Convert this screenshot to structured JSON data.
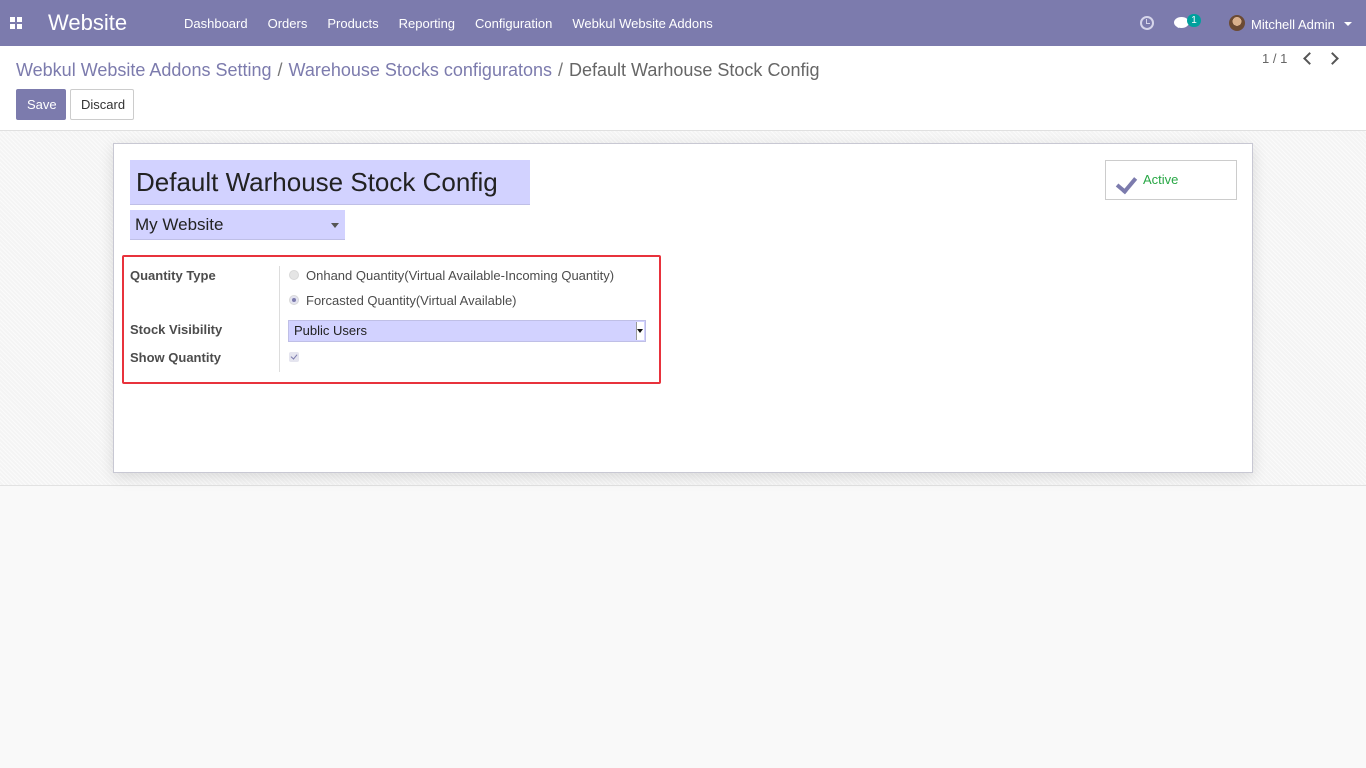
{
  "navbar": {
    "app_name": "Website",
    "menu": [
      "Dashboard",
      "Orders",
      "Products",
      "Reporting",
      "Configuration",
      "Webkul Website Addons"
    ],
    "chat_count": "1",
    "user_name": "Mitchell Admin",
    "color": "#7c7bad"
  },
  "breadcrumb": {
    "items": [
      "Webkul Website Addons Setting",
      "Warehouse Stocks configuratons"
    ],
    "separator": "/",
    "current": "Default Warhouse Stock Config"
  },
  "buttons": {
    "save": "Save",
    "discard": "Discard"
  },
  "pager": {
    "value": "1 / 1"
  },
  "form": {
    "name": "Default Warhouse Stock Config",
    "website": "My Website",
    "active_label": "Active",
    "quantity_type": {
      "label": "Quantity Type",
      "options": [
        {
          "label": "Onhand Quantity(Virtual Available-Incoming Quantity)",
          "checked": false
        },
        {
          "label": "Forcasted Quantity(Virtual Available)",
          "checked": true
        }
      ]
    },
    "stock_visibility": {
      "label": "Stock Visibility",
      "value": "Public Users"
    },
    "show_quantity": {
      "label": "Show Quantity",
      "checked": true
    }
  },
  "colors": {
    "primary": "#7c7bad",
    "active": "#28a745",
    "highlight": "#e8323c",
    "field_bg": "#d2d2ff"
  }
}
